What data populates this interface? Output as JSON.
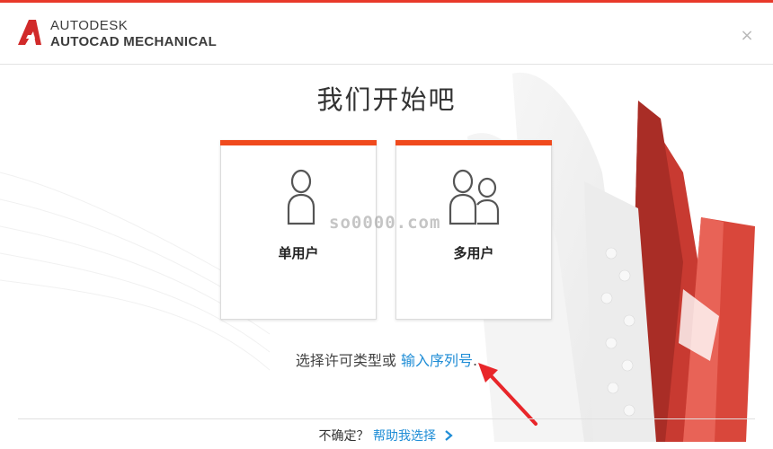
{
  "header": {
    "brand_top": "AUTODESK",
    "brand_product": "AUTOCAD MECHANICAL",
    "close_glyph": "×"
  },
  "main": {
    "title": "我们开始吧",
    "cards": [
      {
        "label": "单用户",
        "icon": "single-user-icon"
      },
      {
        "label": "多用户",
        "icon": "multi-user-icon"
      }
    ],
    "watermark": "so0000.com",
    "license_prefix": "选择许可类型或",
    "license_link": "输入序列号",
    "license_suffix": "."
  },
  "footer": {
    "question": "不确定？",
    "help_link": "帮助我选择"
  },
  "colors": {
    "accent": "#f04a1d",
    "link": "#1f8dd6",
    "annotation_arrow": "#e8262a"
  }
}
